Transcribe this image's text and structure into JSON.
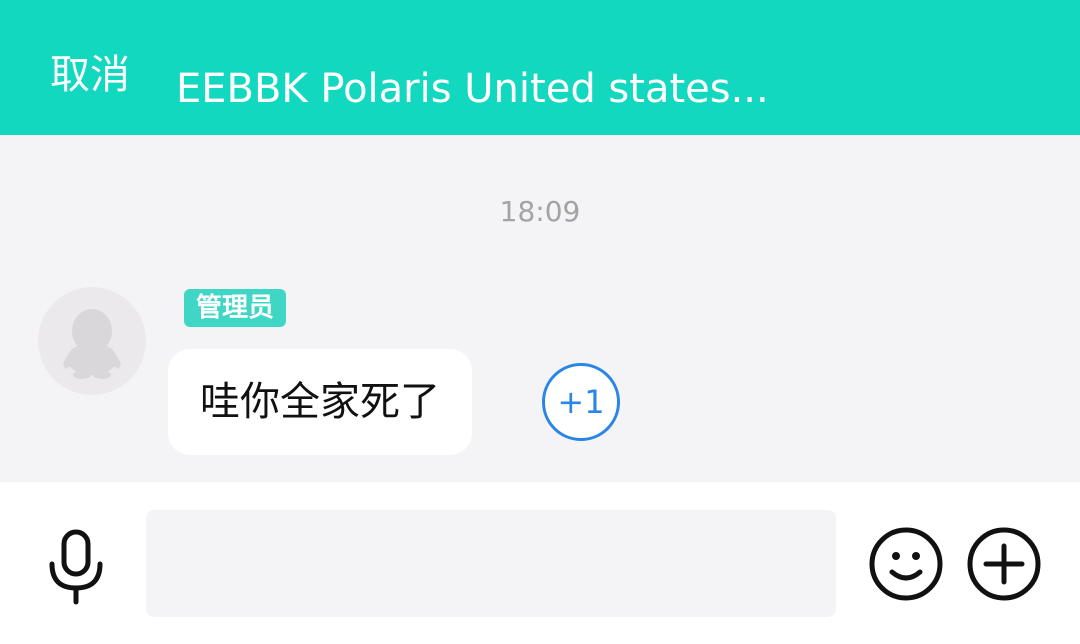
{
  "header": {
    "cancel_label": "取消",
    "title": "EEBBK Polaris United states..."
  },
  "chat": {
    "timestamp": "18:09",
    "message": {
      "avatar": "qq-penguin-default-avatar",
      "role_badge": "管理员",
      "text": "哇你全家死了",
      "plus_one_label": "+1"
    }
  },
  "input_bar": {
    "voice_icon": "microphone-icon",
    "input_value": "",
    "emoji_icon": "smiley-icon",
    "more_icon": "plus-circle-icon"
  },
  "colors": {
    "header": "#13d8c0",
    "badge": "#3fd6c6",
    "plus_one": "#2a86e6",
    "background": "#f4f4f6"
  }
}
